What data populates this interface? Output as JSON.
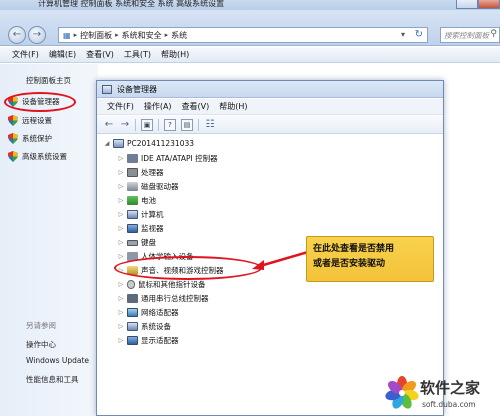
{
  "outer_window": {
    "title_fragment": "计算机管理 控制面板 系统和安全 系统 高级系统设置",
    "address_crumbs": [
      "控制面板",
      "系统和安全",
      "系统"
    ],
    "search_placeholder": "搜索控制面板",
    "menu": [
      "文件(F)",
      "编辑(E)",
      "查看(V)",
      "工具(T)",
      "帮助(H)"
    ]
  },
  "left_pane": {
    "home": "控制面板主页",
    "items": [
      "设备管理器",
      "远程设置",
      "系统保护",
      "高级系统设置"
    ],
    "see_also_title": "另请参阅",
    "see_also": [
      "操作中心",
      "Windows Update",
      "性能信息和工具"
    ]
  },
  "device_manager": {
    "title": "设备管理器",
    "menu": [
      "文件(F)",
      "操作(A)",
      "查看(V)",
      "帮助(H)"
    ],
    "root": "PC201411231033",
    "nodes": [
      "IDE ATA/ATAPI 控制器",
      "处理器",
      "磁盘驱动器",
      "电池",
      "计算机",
      "监视器",
      "键盘",
      "人体学输入设备",
      "声音、视频和游戏控制器",
      "鼠标和其他指针设备",
      "通用串行总线控制器",
      "网络适配器",
      "系统设备",
      "显示适配器"
    ]
  },
  "annotation": {
    "line1": "在此处查看是否禁用",
    "line2": "或者是否安装驱动"
  },
  "watermark": {
    "brand": "软件之家",
    "domain": "soft.duba.com"
  },
  "colors": {
    "highlight": "#e0141e",
    "callout": "#f3c23a",
    "accent": "#3a6fb7"
  }
}
